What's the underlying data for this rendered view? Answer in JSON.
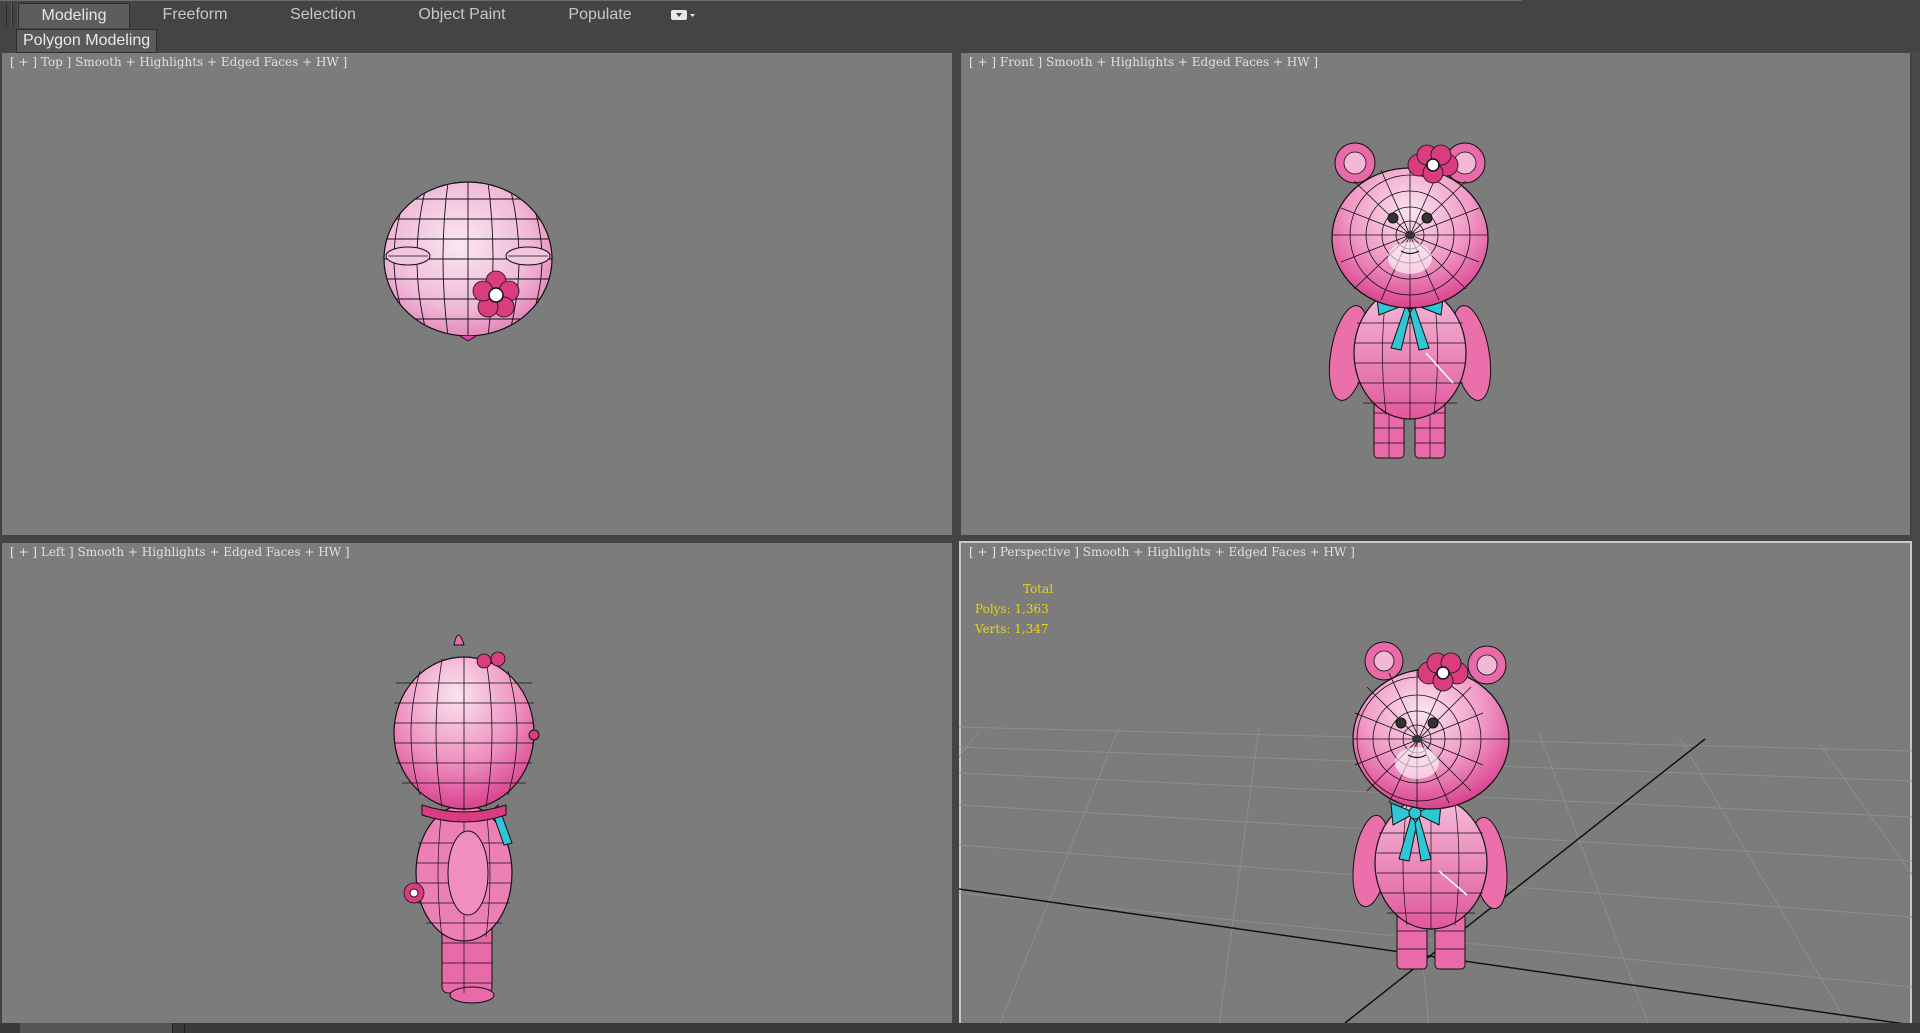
{
  "ribbon": {
    "tabs": [
      {
        "label": "Modeling",
        "active": true
      },
      {
        "label": "Freeform",
        "active": false
      },
      {
        "label": "Selection",
        "active": false
      },
      {
        "label": "Object Paint",
        "active": false
      },
      {
        "label": "Populate",
        "active": false
      }
    ],
    "options_icon": "ribbon-options-icon"
  },
  "subribbon": {
    "label": "Polygon Modeling"
  },
  "viewports": {
    "top": {
      "label": "[ + ] Top ] Smooth + Highlights + Edged Faces + HW ]"
    },
    "front": {
      "label": "[ + ] Front ] Smooth + Highlights + Edged Faces + HW ]"
    },
    "left": {
      "label": "[ + ] Left ] Smooth + Highlights + Edged Faces + HW ]"
    },
    "perspective": {
      "label": "[ + ] Perspective ] Smooth + Highlights + Edged Faces + HW ]",
      "stats": {
        "title": "Total",
        "polys": "Polys: 1,363",
        "verts": "Verts: 1,347"
      }
    }
  },
  "colors": {
    "viewport_bg": "#7c7c7c",
    "ui_bg": "#444444",
    "model_pink": "#e8559a",
    "model_light": "#f6d6e8",
    "bow_cyan": "#2fc6d6",
    "stats_text": "#e8d21a"
  }
}
